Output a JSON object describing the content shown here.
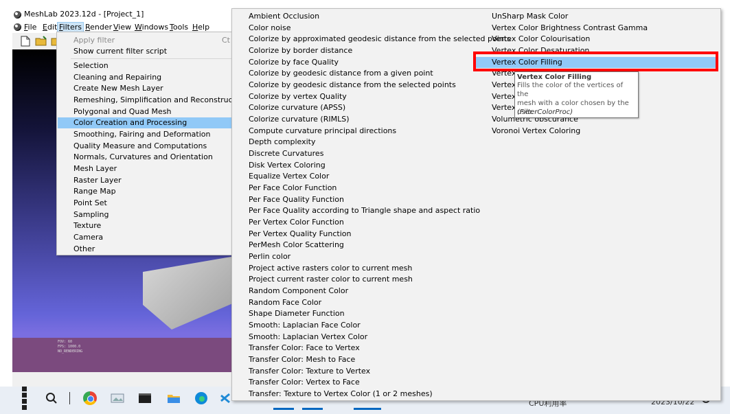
{
  "window": {
    "title": "MeshLab 2023.12d - [Project_1]"
  },
  "menubar": [
    "File",
    "Edit",
    "Filters",
    "Render",
    "View",
    "Windows",
    "Tools",
    "Help"
  ],
  "viewport": {
    "info_lines": [
      "FOV: 60",
      "FPS:  1000.0",
      "NO_RENDERING"
    ]
  },
  "filters_menu": {
    "apply_filter": "Apply filter",
    "apply_filter_shortcut": "Ct",
    "show_script": "Show current filter script",
    "categories": [
      "Selection",
      "Cleaning and Repairing",
      "Create New Mesh Layer",
      "Remeshing, Simplification and Reconstruction",
      "Polygonal and Quad Mesh",
      "Color Creation and Processing",
      "Smoothing, Fairing and Deformation",
      "Quality Measure and Computations",
      "Normals, Curvatures and Orientation",
      "Mesh Layer",
      "Raster Layer",
      "Range Map",
      "Point Set",
      "Sampling",
      "Texture",
      "Camera",
      "Other"
    ],
    "selected": "Color Creation and Processing"
  },
  "submenu": {
    "column1": [
      "Ambient Occlusion",
      "Color noise",
      "Colorize by approximated geodesic distance from the selected points",
      "Colorize by border distance",
      "Colorize by face Quality",
      "Colorize by geodesic distance from a given point",
      "Colorize by geodesic distance from the selected points",
      "Colorize by vertex Quality",
      "Colorize curvature (APSS)",
      "Colorize curvature (RIMLS)",
      "Compute curvature principal directions",
      "Depth complexity",
      "Discrete Curvatures",
      "Disk Vertex Coloring",
      "Equalize Vertex Color",
      "Per Face Color Function",
      "Per Face Quality Function",
      "Per Face Quality according to Triangle shape and aspect ratio",
      "Per Vertex Color Function",
      "Per Vertex Quality Function",
      "PerMesh Color Scattering",
      "Perlin color",
      "Project active rasters color to current mesh",
      "Project current raster color to current mesh",
      "Random Component Color",
      "Random Face Color",
      "Shape Diameter Function",
      "Smooth: Laplacian Face Color",
      "Smooth: Laplacian Vertex Color",
      "Transfer Color: Face to Vertex",
      "Transfer Color: Mesh to Face",
      "Transfer Color: Texture to Vertex",
      "Transfer Color: Vertex to Face",
      "Transfer: Texture to Vertex Color (1 or 2 meshes)"
    ],
    "column2": [
      "UnSharp Mask Color",
      "Vertex Color Brightness Contrast Gamma",
      "Vertex Color Colourisation",
      "Vertex Color Desaturation",
      "Vertex Color Filling",
      "Vertex Color Invert",
      "Vertex Color Levels Adjustment",
      "Vertex Color Noise",
      "Vertex Color Thresholding",
      "Volumetric obscurance",
      "Voronoi Vertex Coloring"
    ],
    "selected": "Vertex Color Filling"
  },
  "tooltip": {
    "title": "Vertex Color Filling",
    "line1": "Fills the color of the vertices of the",
    "line2": "mesh with a color chosen by the user.",
    "code": "(FilterColorProc)"
  },
  "taskbar": {
    "tray_text": "CPU利用率",
    "clock": "2023/10/22"
  },
  "colors": {
    "menu_bg": "#f2f2f2",
    "menu_selected": "#91c9f7",
    "highlight": "#ff0000",
    "viewport_top": "#000000",
    "viewport_bottom": "#6464d8",
    "info_band": "#7b4a7e",
    "taskbar_bg": "#e9eef5",
    "taskbar_active": "#0067c0"
  }
}
